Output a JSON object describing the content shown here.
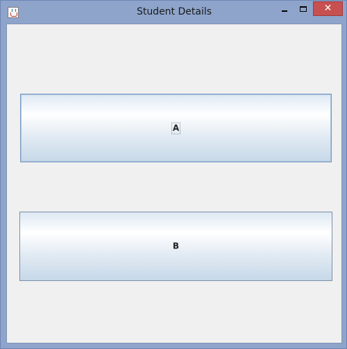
{
  "window": {
    "title": "Student Details",
    "app_icon": "java-coffee-cup-icon",
    "controls": {
      "minimize_icon": "minimize-icon",
      "maximize_icon": "maximize-icon",
      "close_icon": "close-icon",
      "close_glyph": "✕"
    },
    "accent_color": "#8ea4cb",
    "close_color": "#c75050"
  },
  "buttons": [
    {
      "label": "A",
      "focused": true
    },
    {
      "label": "B",
      "focused": false
    }
  ]
}
